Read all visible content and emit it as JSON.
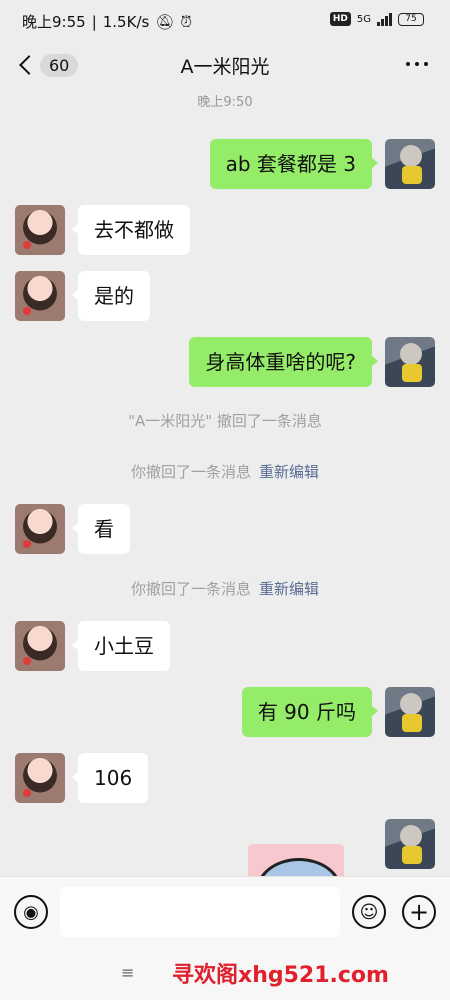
{
  "status": {
    "time": "晚上9:55",
    "speed": "1.5K/s",
    "hd": "HD",
    "network": "5G",
    "battery": "75"
  },
  "header": {
    "back_count": "60",
    "title": "A一米阳光"
  },
  "timestamp": "晚上9:50",
  "messages": [
    {
      "side": "out",
      "text": "ab 套餐都是 3"
    },
    {
      "side": "in",
      "text": "去不都做"
    },
    {
      "side": "in",
      "text": "是的"
    },
    {
      "side": "out",
      "text": "身高体重啥的呢?"
    },
    {
      "side": "in",
      "text": "看"
    },
    {
      "side": "in",
      "text": "小土豆"
    },
    {
      "side": "out",
      "text": "有 90 斤吗"
    },
    {
      "side": "in",
      "text": "106"
    }
  ],
  "notices": [
    {
      "text": "\"A一米阳光\" 撤回了一条消息",
      "action": ""
    },
    {
      "text": "你撤回了一条消息",
      "action": "重新编辑"
    },
    {
      "text": "你撤回了一条消息",
      "action": "重新编辑"
    }
  ],
  "input": {
    "placeholder": ""
  },
  "footer": {
    "menu_icon": "≡",
    "watermark": "寻欢阁xhg521.com"
  }
}
